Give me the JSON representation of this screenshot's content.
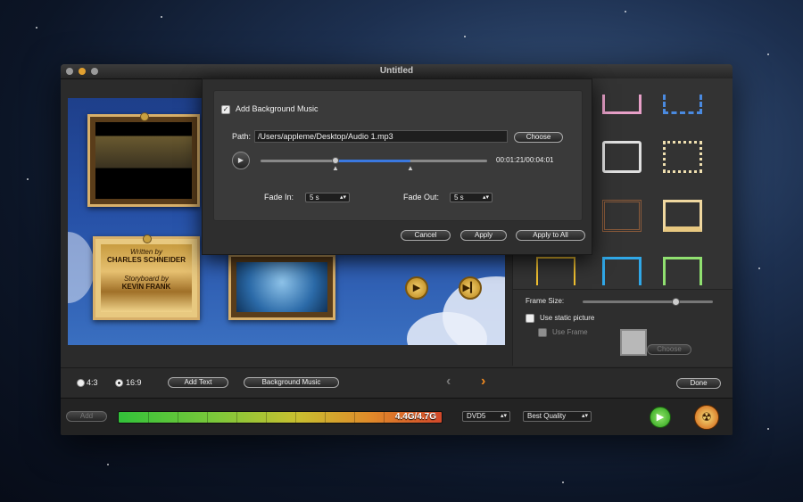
{
  "window": {
    "title": "Untitled"
  },
  "dialog": {
    "checkbox_label": "Add Background Music",
    "path_label": "Path:",
    "path_value": "/Users/appleme/Desktop/Audio 1.mp3",
    "choose_label": "Choose",
    "time": "00:01:21/00:04:01",
    "fade_in_label": "Fade In:",
    "fade_in_value": "5 s",
    "fade_out_label": "Fade Out:",
    "fade_out_value": "5 s",
    "cancel_label": "Cancel",
    "apply_label": "Apply",
    "apply_all_label": "Apply to All"
  },
  "preview": {
    "card_written_by": "Written by",
    "card_name1": "CHARLES SCHNEIDER",
    "card_storyboard": "Storyboard by",
    "card_name2": "KEVIN FRANK"
  },
  "panel": {
    "frame_size_label": "Frame Size:",
    "static_picture_label": "Use static picture",
    "use_frame_label": "Use Frame",
    "choose_label": "Choose"
  },
  "toolbar": {
    "ratio_43": "4:3",
    "ratio_169": "16:9",
    "add_text_label": "Add Text",
    "bg_music_label": "Background Music",
    "done_label": "Done",
    "add_label": "Add",
    "capacity": "4.4G/4.7G",
    "disc_type": "DVD5",
    "quality": "Best Quality"
  },
  "colors": {
    "accent": "#3a78e0",
    "capacity_start": "#32c23a",
    "capacity_end": "#d2482a"
  }
}
